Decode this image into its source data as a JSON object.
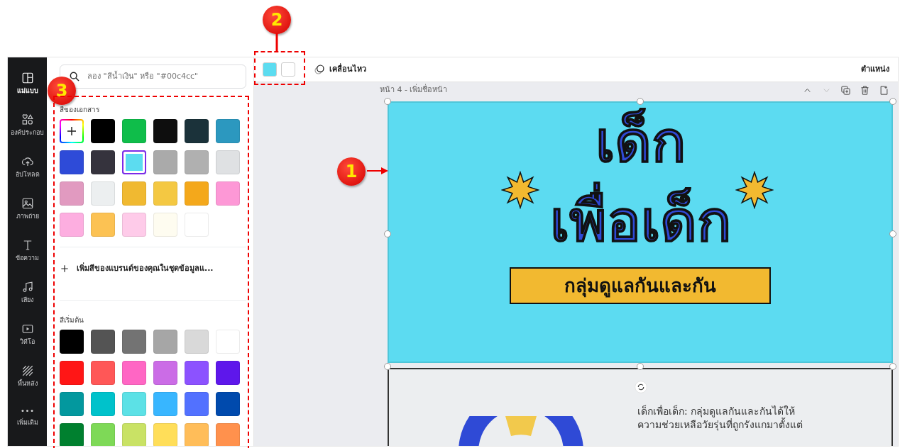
{
  "annotations": [
    {
      "label": "1"
    },
    {
      "label": "2"
    },
    {
      "label": "3"
    }
  ],
  "sidebar": {
    "items": [
      {
        "label": "แม่แบบ",
        "selected": true
      },
      {
        "label": "องค์ประกอบ",
        "selected": false
      },
      {
        "label": "อัปโหลด",
        "selected": false
      },
      {
        "label": "ภาพถ่าย",
        "selected": false
      },
      {
        "label": "ข้อความ",
        "selected": false
      },
      {
        "label": "เสียง",
        "selected": false
      },
      {
        "label": "วิดีโอ",
        "selected": false
      },
      {
        "label": "พื้นหลัง",
        "selected": false
      },
      {
        "label": "เพิ่มเติม",
        "selected": false
      }
    ]
  },
  "color_panel": {
    "search": {
      "placeholder": "ลอง \"สีน้ำเงิน\" หรือ \"#00c4cc\""
    },
    "document_colors": {
      "title": "สีของเอกสาร",
      "swatches": [
        {
          "color": "#000000",
          "selected": false
        },
        {
          "color": "#0fbd4a",
          "selected": false
        },
        {
          "color": "#0e0e0e",
          "selected": false
        },
        {
          "color": "#1b323a",
          "selected": false
        },
        {
          "color": "#2c98bf",
          "selected": false
        },
        {
          "color": "#2e4bd8",
          "selected": false
        },
        {
          "color": "#35333d",
          "selected": false
        },
        {
          "color": "#5cdcf0",
          "selected": true
        },
        {
          "color": "#aaaaaa",
          "selected": false
        },
        {
          "color": "#b0b0b0",
          "selected": false
        },
        {
          "color": "#dfe1e3",
          "selected": false
        },
        {
          "color": "#e19ac0",
          "selected": false
        },
        {
          "color": "#eceff0",
          "selected": false
        },
        {
          "color": "#f0b931",
          "selected": false
        },
        {
          "color": "#f4c842",
          "selected": false
        },
        {
          "color": "#f4a81b",
          "selected": false
        },
        {
          "color": "#fd98d6",
          "selected": false
        },
        {
          "color": "#fdaee0",
          "selected": false
        },
        {
          "color": "#fcc253",
          "selected": false
        },
        {
          "color": "#fecbe9",
          "selected": false
        },
        {
          "color": "#fefcf0",
          "selected": false
        },
        {
          "color": "#ffffff",
          "selected": false
        }
      ]
    },
    "brand_prompt": "เพิ่มสีของแบรนด์ของคุณในชุดข้อมูลแ...",
    "default_colors": {
      "title": "สีเริ่มต้น",
      "swatches": [
        {
          "color": "#000000",
          "selected": false
        },
        {
          "color": "#545454",
          "selected": false
        },
        {
          "color": "#737373",
          "selected": false
        },
        {
          "color": "#a6a6a6",
          "selected": false
        },
        {
          "color": "#d9d9d9",
          "selected": false
        },
        {
          "color": "#ffffff",
          "selected": false
        },
        {
          "color": "#ff1616",
          "selected": false
        },
        {
          "color": "#ff5757",
          "selected": false
        },
        {
          "color": "#ff66c4",
          "selected": false
        },
        {
          "color": "#cb6ce6",
          "selected": false
        },
        {
          "color": "#8c52ff",
          "selected": false
        },
        {
          "color": "#5e17eb",
          "selected": false
        },
        {
          "color": "#03989e",
          "selected": false
        },
        {
          "color": "#00c2cb",
          "selected": false
        },
        {
          "color": "#5ce1e6",
          "selected": false
        },
        {
          "color": "#38b6ff",
          "selected": false
        },
        {
          "color": "#5271ff",
          "selected": false
        },
        {
          "color": "#004aad",
          "selected": false
        },
        {
          "color": "#00802f",
          "selected": false
        },
        {
          "color": "#7ed957",
          "selected": false
        },
        {
          "color": "#c9e265",
          "selected": false
        },
        {
          "color": "#ffde59",
          "selected": false
        },
        {
          "color": "#ffbd59",
          "selected": false
        },
        {
          "color": "#ff914d",
          "selected": false
        }
      ]
    }
  },
  "toolbar": {
    "color_chips": [
      {
        "color": "#5cdcf0"
      },
      {
        "color": "#ffffff"
      }
    ],
    "animate": "เคลื่อนไหว",
    "position": "ตำแหน่ง"
  },
  "page": {
    "header": "หน้า 4 - เพิ่มชื่อหน้า",
    "title_lines": [
      "เด็ก",
      "เพื่อเด็ก"
    ],
    "subtitle": "กลุ่มดูแลกันและกัน"
  },
  "next_page": {
    "text_lines": [
      "เด็กเพื่อเด็ก: กลุ่มดูแลกันและกันได้ให้",
      "ความช่วยเหลือวัยรุ่นที่ถูกรังแกมาตั้งแต่"
    ]
  }
}
